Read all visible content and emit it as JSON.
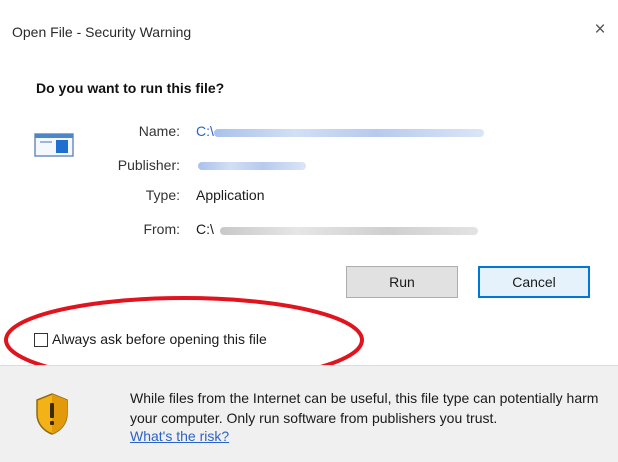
{
  "dialog": {
    "title": "Open File - Security Warning",
    "close_glyph": "×",
    "heading": "Do you want to run this file?"
  },
  "file": {
    "name_label": "Name:",
    "name_value": "C:\\",
    "publisher_label": "Publisher:",
    "type_label": "Type:",
    "type_value": "Application",
    "from_label": "From:",
    "from_value": "C:\\"
  },
  "buttons": {
    "run": "Run",
    "cancel": "Cancel"
  },
  "checkbox": {
    "label": "Always ask before opening this file",
    "checked": false
  },
  "warning": {
    "text": "While files from the Internet can be useful, this file type can potentially harm your computer. Only run software from publishers you trust.",
    "link": "What's the risk?"
  },
  "icons": {
    "file": "application-window-icon",
    "shield": "security-shield-icon",
    "close": "close-icon"
  },
  "colors": {
    "link": "#2a63c8",
    "default_button_border": "#0078d7",
    "annotation_circle": "#e0141e",
    "footer_background": "#f0f0f0"
  }
}
